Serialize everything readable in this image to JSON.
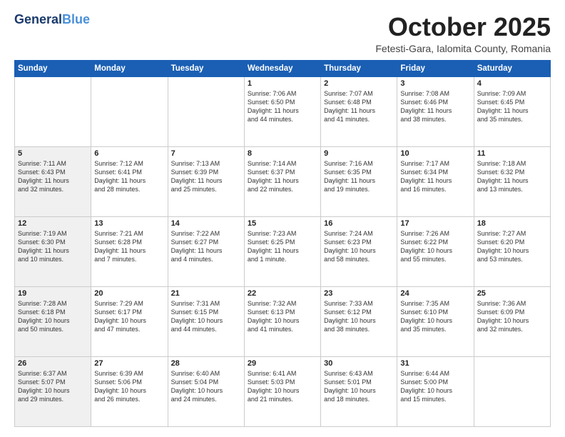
{
  "header": {
    "logo_line1": "General",
    "logo_line1_accent": "Blue",
    "month": "October 2025",
    "location": "Fetesti-Gara, Ialomita County, Romania"
  },
  "weekdays": [
    "Sunday",
    "Monday",
    "Tuesday",
    "Wednesday",
    "Thursday",
    "Friday",
    "Saturday"
  ],
  "weeks": [
    [
      {
        "day": "",
        "info": "",
        "shaded": false
      },
      {
        "day": "",
        "info": "",
        "shaded": false
      },
      {
        "day": "",
        "info": "",
        "shaded": false
      },
      {
        "day": "1",
        "info": "Sunrise: 7:06 AM\nSunset: 6:50 PM\nDaylight: 11 hours\nand 44 minutes.",
        "shaded": false
      },
      {
        "day": "2",
        "info": "Sunrise: 7:07 AM\nSunset: 6:48 PM\nDaylight: 11 hours\nand 41 minutes.",
        "shaded": false
      },
      {
        "day": "3",
        "info": "Sunrise: 7:08 AM\nSunset: 6:46 PM\nDaylight: 11 hours\nand 38 minutes.",
        "shaded": false
      },
      {
        "day": "4",
        "info": "Sunrise: 7:09 AM\nSunset: 6:45 PM\nDaylight: 11 hours\nand 35 minutes.",
        "shaded": false
      }
    ],
    [
      {
        "day": "5",
        "info": "Sunrise: 7:11 AM\nSunset: 6:43 PM\nDaylight: 11 hours\nand 32 minutes.",
        "shaded": true
      },
      {
        "day": "6",
        "info": "Sunrise: 7:12 AM\nSunset: 6:41 PM\nDaylight: 11 hours\nand 28 minutes.",
        "shaded": false
      },
      {
        "day": "7",
        "info": "Sunrise: 7:13 AM\nSunset: 6:39 PM\nDaylight: 11 hours\nand 25 minutes.",
        "shaded": false
      },
      {
        "day": "8",
        "info": "Sunrise: 7:14 AM\nSunset: 6:37 PM\nDaylight: 11 hours\nand 22 minutes.",
        "shaded": false
      },
      {
        "day": "9",
        "info": "Sunrise: 7:16 AM\nSunset: 6:35 PM\nDaylight: 11 hours\nand 19 minutes.",
        "shaded": false
      },
      {
        "day": "10",
        "info": "Sunrise: 7:17 AM\nSunset: 6:34 PM\nDaylight: 11 hours\nand 16 minutes.",
        "shaded": false
      },
      {
        "day": "11",
        "info": "Sunrise: 7:18 AM\nSunset: 6:32 PM\nDaylight: 11 hours\nand 13 minutes.",
        "shaded": false
      }
    ],
    [
      {
        "day": "12",
        "info": "Sunrise: 7:19 AM\nSunset: 6:30 PM\nDaylight: 11 hours\nand 10 minutes.",
        "shaded": true
      },
      {
        "day": "13",
        "info": "Sunrise: 7:21 AM\nSunset: 6:28 PM\nDaylight: 11 hours\nand 7 minutes.",
        "shaded": false
      },
      {
        "day": "14",
        "info": "Sunrise: 7:22 AM\nSunset: 6:27 PM\nDaylight: 11 hours\nand 4 minutes.",
        "shaded": false
      },
      {
        "day": "15",
        "info": "Sunrise: 7:23 AM\nSunset: 6:25 PM\nDaylight: 11 hours\nand 1 minute.",
        "shaded": false
      },
      {
        "day": "16",
        "info": "Sunrise: 7:24 AM\nSunset: 6:23 PM\nDaylight: 10 hours\nand 58 minutes.",
        "shaded": false
      },
      {
        "day": "17",
        "info": "Sunrise: 7:26 AM\nSunset: 6:22 PM\nDaylight: 10 hours\nand 55 minutes.",
        "shaded": false
      },
      {
        "day": "18",
        "info": "Sunrise: 7:27 AM\nSunset: 6:20 PM\nDaylight: 10 hours\nand 53 minutes.",
        "shaded": false
      }
    ],
    [
      {
        "day": "19",
        "info": "Sunrise: 7:28 AM\nSunset: 6:18 PM\nDaylight: 10 hours\nand 50 minutes.",
        "shaded": true
      },
      {
        "day": "20",
        "info": "Sunrise: 7:29 AM\nSunset: 6:17 PM\nDaylight: 10 hours\nand 47 minutes.",
        "shaded": false
      },
      {
        "day": "21",
        "info": "Sunrise: 7:31 AM\nSunset: 6:15 PM\nDaylight: 10 hours\nand 44 minutes.",
        "shaded": false
      },
      {
        "day": "22",
        "info": "Sunrise: 7:32 AM\nSunset: 6:13 PM\nDaylight: 10 hours\nand 41 minutes.",
        "shaded": false
      },
      {
        "day": "23",
        "info": "Sunrise: 7:33 AM\nSunset: 6:12 PM\nDaylight: 10 hours\nand 38 minutes.",
        "shaded": false
      },
      {
        "day": "24",
        "info": "Sunrise: 7:35 AM\nSunset: 6:10 PM\nDaylight: 10 hours\nand 35 minutes.",
        "shaded": false
      },
      {
        "day": "25",
        "info": "Sunrise: 7:36 AM\nSunset: 6:09 PM\nDaylight: 10 hours\nand 32 minutes.",
        "shaded": false
      }
    ],
    [
      {
        "day": "26",
        "info": "Sunrise: 6:37 AM\nSunset: 5:07 PM\nDaylight: 10 hours\nand 29 minutes.",
        "shaded": true
      },
      {
        "day": "27",
        "info": "Sunrise: 6:39 AM\nSunset: 5:06 PM\nDaylight: 10 hours\nand 26 minutes.",
        "shaded": false
      },
      {
        "day": "28",
        "info": "Sunrise: 6:40 AM\nSunset: 5:04 PM\nDaylight: 10 hours\nand 24 minutes.",
        "shaded": false
      },
      {
        "day": "29",
        "info": "Sunrise: 6:41 AM\nSunset: 5:03 PM\nDaylight: 10 hours\nand 21 minutes.",
        "shaded": false
      },
      {
        "day": "30",
        "info": "Sunrise: 6:43 AM\nSunset: 5:01 PM\nDaylight: 10 hours\nand 18 minutes.",
        "shaded": false
      },
      {
        "day": "31",
        "info": "Sunrise: 6:44 AM\nSunset: 5:00 PM\nDaylight: 10 hours\nand 15 minutes.",
        "shaded": false
      },
      {
        "day": "",
        "info": "",
        "shaded": false
      }
    ]
  ]
}
